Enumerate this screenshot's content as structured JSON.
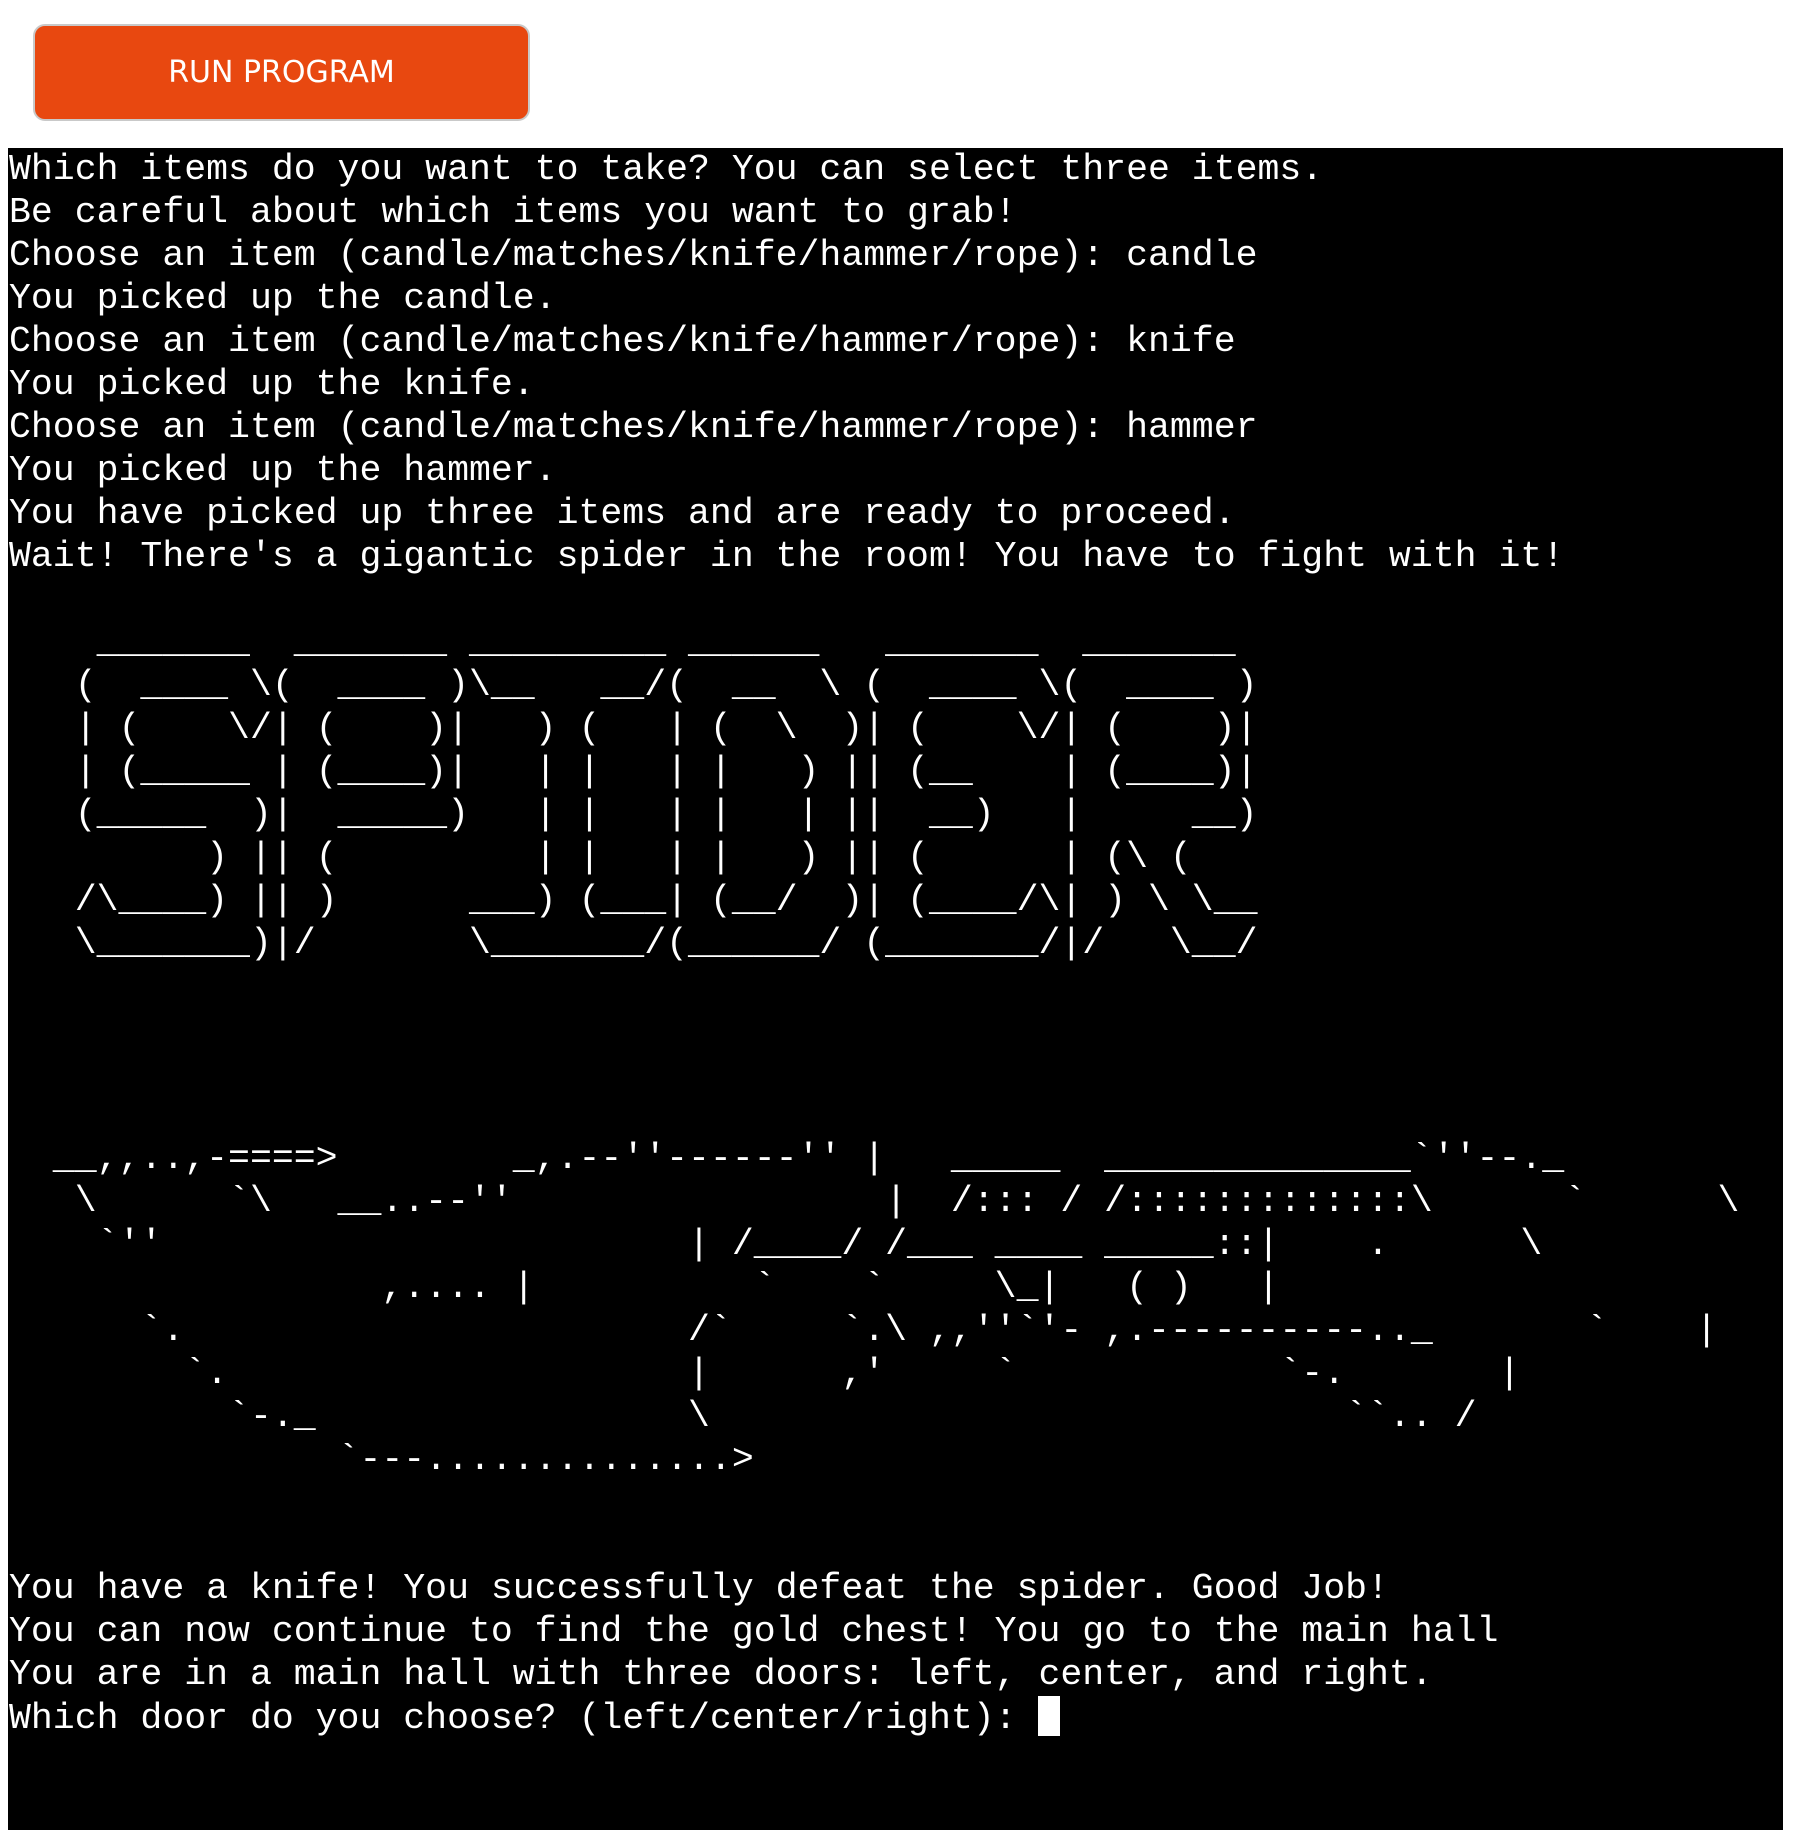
{
  "run_button": {
    "label": "RUN PROGRAM"
  },
  "terminal": {
    "output": "Which items do you want to take? You can select three items.\nBe careful about which items you want to grab!\nChoose an item (candle/matches/knife/hammer/rope): candle\nYou picked up the candle.\nChoose an item (candle/matches/knife/hammer/rope): knife\nYou picked up the knife.\nChoose an item (candle/matches/knife/hammer/rope): hammer\nYou picked up the hammer.\nYou have picked up three items and are ready to proceed.\nWait! There's a gigantic spider in the room! You have to fight with it!\n\n    _______  _______ _________ ______   _______  _______\n   (  ____ \\(  ____ )\\__   __/(  __  \\ (  ____ \\(  ____ )\n   | (    \\/| (    )|   ) (   | (  \\  )| (    \\/| (    )|\n   | (_____ | (____)|   | |   | |   ) || (__    | (____)|\n   (_____  )|  _____)   | |   | |   | ||  __)   |     __)\n         ) || (         | |   | |   ) || (      | (\\ (\n   /\\____) || )      ___) (___| (__/  )| (____/\\| ) \\ \\__\n   \\_______)|/       \\_______/(______/ (_______/|/   \\__/\n\n\n\n\n  __,,..,-====>        _,.--''------'' |   _____  ______________`''--._\n   \\      `\\   __..--''                 |  /::: / /:::::::::::::\\      `      \\\n    `''                        | /____/ /___ ____ _____::|    .      \\\n                 ,.... |          `    `     \\_|   ( )   |\n      `.                       /`     `.\\ ,,''`'- ,.----------.._       `    |\n        `.                     |      ,'     `            `-.       |\n          `-._                 \\                             ``.. /\n               `---..............>\n\n\nYou have a knife! You successfully defeat the spider. Good Job!\nYou can now continue to find the gold chest! You go to the main hall\nYou are in a main hall with three doors: left, center, and right.\nWhich door do you choose? (left/center/right): "
  }
}
